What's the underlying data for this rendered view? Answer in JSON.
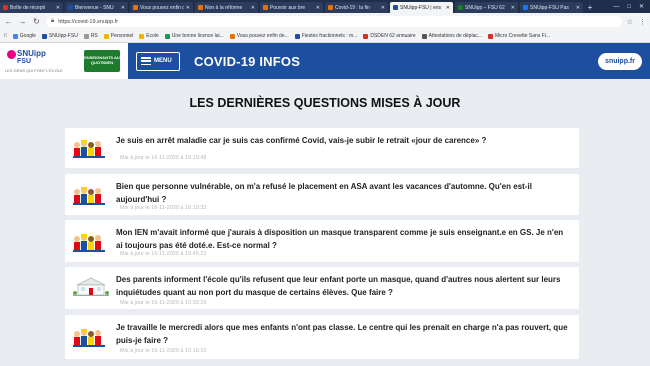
{
  "browser": {
    "tabs": [
      {
        "label": "Boîte de récepti",
        "icon_color": "#d93025",
        "active": false
      },
      {
        "label": "Bienvenue - SNU",
        "icon_color": "#1c4fa0",
        "active": false
      },
      {
        "label": "Vous pouvez enfin d",
        "icon_color": "#e8710a",
        "active": false
      },
      {
        "label": "Non à la réforme",
        "icon_color": "#e8710a",
        "active": false
      },
      {
        "label": "Pouvoir aux bre",
        "icon_color": "#e8710a",
        "active": false
      },
      {
        "label": "Covid-19 : la fin",
        "icon_color": "#e8710a",
        "active": false
      },
      {
        "label": "SNUipp-FSU | ens",
        "icon_color": "#1c4fa0",
        "active": true
      },
      {
        "label": "SNUipp – FSU 62",
        "icon_color": "#1e7a2d",
        "active": false
      },
      {
        "label": "SNUipp-FSU Pas",
        "icon_color": "#1877f2",
        "active": false
      }
    ],
    "url": "https://covid-19.snuipp.fr",
    "bookmarks": [
      {
        "label": "Google",
        "icon_color": "#4285f4"
      },
      {
        "label": "SNUipp-FSU",
        "icon_color": "#1c4fa0"
      },
      {
        "label": "RS",
        "icon_color": "#999999"
      },
      {
        "label": "Personnel",
        "icon_color": "#f4b400"
      },
      {
        "label": "Ecole",
        "icon_color": "#f4b400"
      },
      {
        "label": "Une bonne licence lai...",
        "icon_color": "#0f9d58"
      },
      {
        "label": "Vous pouvez enfin de...",
        "icon_color": "#e8710a"
      },
      {
        "label": "Fiestes fractionnels : m...",
        "icon_color": "#1c4fa0"
      },
      {
        "label": "DSDEN 62 annuaire",
        "icon_color": "#d93025"
      },
      {
        "label": "Attestations de déplac...",
        "icon_color": "#555555"
      },
      {
        "label": "Micro Crevette Sans Fi...",
        "icon_color": "#d93025"
      }
    ]
  },
  "site": {
    "logo_name": "SNUipp",
    "logo_fsu": "FSU",
    "logo_tagline": "LES GENS QUI FONT L'ÉCOLE",
    "logo2_text": "ENSEIGNANTS AU QUOTIDIEN",
    "menu_label": "MENU",
    "title": "COVID-19 INFOS",
    "badge": "snuipp.fr"
  },
  "main": {
    "heading": "LES DERNIÈRES QUESTIONS MISES À JOUR",
    "questions": [
      {
        "text": "Je suis en arrêt maladie car je suis cas confirmé Covid, vais-je subir le retrait «jour de carence» ?",
        "updated": "Mis à jour le 16-11-2020 à 16:19:48",
        "thumb": "kids"
      },
      {
        "text": "Bien que personne vulnérable, on m'a refusé le placement en ASA avant les vacances d'automne. Qu'en est-il aujourd'hui ?",
        "updated": "Mis à jour le 16-11-2020 à 16:19:33",
        "thumb": "kids"
      },
      {
        "text": "Mon IEN m'avait informé que j'aurais à disposition un masque transparent comme je suis enseignant.e en GS. Je n'en ai toujours pas été doté.e. Est-ce normal ?",
        "updated": "Mis à jour le 16-11-2020 à 15:45:23",
        "thumb": "kids"
      },
      {
        "text": "Des parents informent l'école qu'ils refusent que leur enfant porte un masque, quand d'autres nous alertent sur leurs inquiétudes quant au non port du masque de certains élèves. Que faire ?",
        "updated": "Mis à jour le 16-11-2020 à 15:32:29",
        "thumb": "school"
      },
      {
        "text": "Je travaille le mercredi alors que mes enfants n'ont pas classe. Le centre qui les prenait en charge n'a pas rouvert, que puis-je faire ?",
        "updated": "Mis à jour le 16-11-2020 à 15:16:10",
        "thumb": "kids"
      }
    ]
  }
}
